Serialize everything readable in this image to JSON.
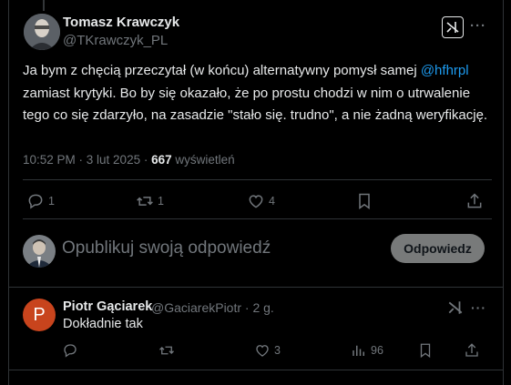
{
  "tweet": {
    "author_name": "Tomasz Krawczyk",
    "author_handle": "@TKrawczyk_PL",
    "text_before_mention": "Ja bym z chęcią przeczytał (w końcu) alternatywny pomysł samej ",
    "mention": "@hfhrpl",
    "text_after_mention": " zamiast krytyki. Bo by się okazało, że po prostu chodzi w nim o utrwalenie tego co się zdarzyło, na zasadzie \"stało się. trudno\", a nie żadną weryfikację.",
    "timestamp": "10:52 PM · 3 lut 2025 · ",
    "views_count": "667",
    "views_label": " wyświetleń",
    "actions": {
      "replies": "1",
      "reposts": "1",
      "likes": "4"
    },
    "more_label": "···"
  },
  "composer": {
    "placeholder": "Opublikuj swoją odpowiedź",
    "button_label": "Odpowiedz"
  },
  "reply": {
    "avatar_letter": "P",
    "author_name": "Piotr Gąciarek",
    "author_handle": "@GaciarekPiotr · 2 g.",
    "text": "Dokładnie tak",
    "likes": "3",
    "views": "96",
    "more_label": "···"
  },
  "colors": {
    "background": "#000000",
    "text": "#e7e9ea",
    "muted": "#71767b",
    "accent": "#1d9bf0",
    "reply_avatar": "#c8441d"
  },
  "icons": [
    "grok-icon",
    "reply-icon",
    "repost-icon",
    "like-icon",
    "bookmark-icon",
    "share-icon",
    "views-icon",
    "more-icon"
  ]
}
